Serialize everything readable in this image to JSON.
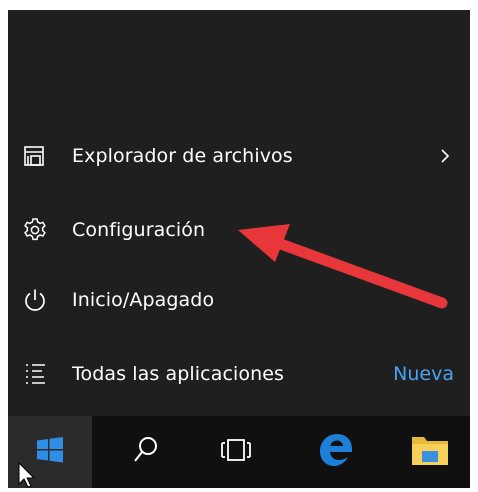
{
  "start_menu": {
    "items": [
      {
        "id": "explorer",
        "label": "Explorador de archivos",
        "icon": "file-explorer-icon",
        "has_submenu": true
      },
      {
        "id": "settings",
        "label": "Configuración",
        "icon": "gear-icon"
      },
      {
        "id": "power",
        "label": "Inicio/Apagado",
        "icon": "power-icon"
      },
      {
        "id": "all-apps",
        "label": "Todas las aplicaciones",
        "icon": "list-icon",
        "badge": "Nueva"
      }
    ]
  },
  "taskbar": {
    "buttons": [
      {
        "id": "start",
        "icon": "windows-logo-icon"
      },
      {
        "id": "search",
        "icon": "search-icon"
      },
      {
        "id": "task-view",
        "icon": "task-view-icon"
      },
      {
        "id": "edge",
        "icon": "edge-icon"
      },
      {
        "id": "explorer",
        "icon": "folder-icon"
      }
    ]
  },
  "colors": {
    "menu_bg": "#1f1f1f",
    "taskbar_bg": "#101010",
    "start_button_bg": "#2b2b2b",
    "accent_blue": "#4aa3f0",
    "annotation_red": "#e8373a"
  }
}
